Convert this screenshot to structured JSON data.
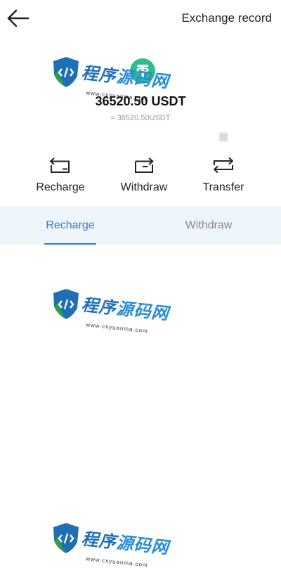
{
  "header": {
    "back_icon": "arrow-left-icon",
    "title": "Exchange record"
  },
  "balance": {
    "coin_icon": "usdt-icon",
    "amount": "36520.50 USDT",
    "approx": "≈ 36520.50USDT"
  },
  "actions": [
    {
      "label": "Recharge",
      "icon": "recharge-icon"
    },
    {
      "label": "Withdraw",
      "icon": "withdraw-icon"
    },
    {
      "label": "Transfer",
      "icon": "transfer-icon"
    }
  ],
  "tabs": [
    {
      "label": "Recharge",
      "active": true
    },
    {
      "label": "Withdraw",
      "active": false
    }
  ],
  "watermark": {
    "text": "程序源码网",
    "url": "www.cxyuanma.com"
  },
  "colors": {
    "accent": "#2a7fd4",
    "tab_background": "#eef5fb",
    "coin_green": "#2bbd8b",
    "muted_text": "#8a8a8a"
  }
}
